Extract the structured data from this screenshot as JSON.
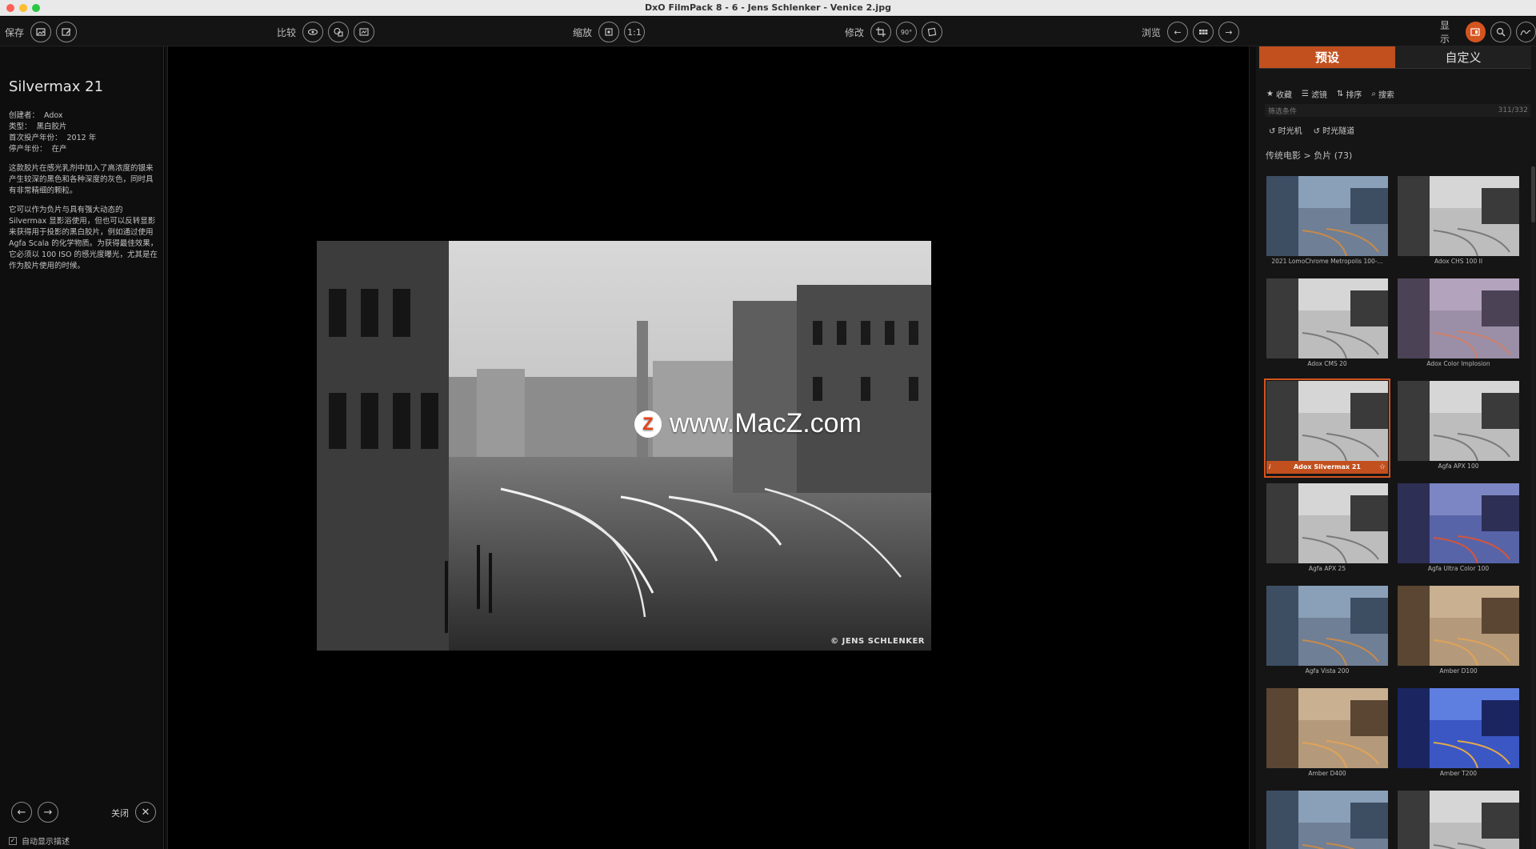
{
  "window": {
    "title": "DxO FilmPack 8 - 6 - Jens Schlenker - Venice 2.jpg"
  },
  "toolbar": {
    "save_label": "保存",
    "compare_label": "比较",
    "zoom_label": "缩放",
    "zoom_one_to_one": "1:1",
    "edit_label": "修改",
    "rotate_label": "90°",
    "browse_label": "浏览",
    "display_label": "显示",
    "accent_color": "#d4541f"
  },
  "info_panel": {
    "title": "Silvermax 21",
    "meta": [
      {
        "key": "创建者：",
        "value": "Adox"
      },
      {
        "key": "类型：",
        "value": "黑白胶片"
      },
      {
        "key": "首次投产年份：",
        "value": "2012 年"
      },
      {
        "key": "停产年份：",
        "value": "在产"
      }
    ],
    "description_1": "这款胶片在感光乳剂中加入了高浓度的银来产生较深的黑色和各种深度的灰色，同时具有非常精细的颗粒。",
    "description_2": "它可以作为负片与具有强大动态的 Silvermax 显影浴使用，但也可以反转显影来获得用于投影的黑白胶片，例如通过使用 Agfa Scala 的化学物质。为获得最佳效果，它必须以 100 ISO 的感光度曝光，尤其是在作为胶片使用的时候。",
    "close_label": "关闭",
    "auto_show_label": "自动显示描述",
    "auto_show_checked": "✓"
  },
  "viewer": {
    "watermark_text": "www.MacZ.com",
    "watermark_logo": "Z",
    "copyright": "© JENS SCHLENKER"
  },
  "presets_panel": {
    "tabs": [
      "预设",
      "自定义"
    ],
    "filters": {
      "favorites": "收藏",
      "filter": "滤镜",
      "sort": "排序",
      "search": "搜索"
    },
    "criteria_placeholder": "筛选条件",
    "count": "311/332",
    "time_machine": "时光机",
    "time_tunnel": "时光隧道",
    "breadcrumb": "传统电影 > 负片 (73)",
    "presets": [
      {
        "name": "2021 LomoChrome Metropolis 100-...",
        "style": "color"
      },
      {
        "name": "Adox CHS 100 II",
        "style": "bw"
      },
      {
        "name": "Adox CMS 20",
        "style": "bw"
      },
      {
        "name": "Adox Color Implosion",
        "style": "warm"
      },
      {
        "name": "Adox Silvermax 21",
        "style": "bw",
        "selected": true
      },
      {
        "name": "Agfa APX 100",
        "style": "bw"
      },
      {
        "name": "Agfa APX 25",
        "style": "bw"
      },
      {
        "name": "Agfa Ultra Color 100",
        "style": "vivid"
      },
      {
        "name": "Agfa Vista 200",
        "style": "color"
      },
      {
        "name": "Amber D100",
        "style": "amber"
      },
      {
        "name": "Amber D400",
        "style": "amber"
      },
      {
        "name": "Amber T200",
        "style": "blue"
      },
      {
        "name": "",
        "style": "color"
      },
      {
        "name": "",
        "style": "bw"
      }
    ]
  }
}
